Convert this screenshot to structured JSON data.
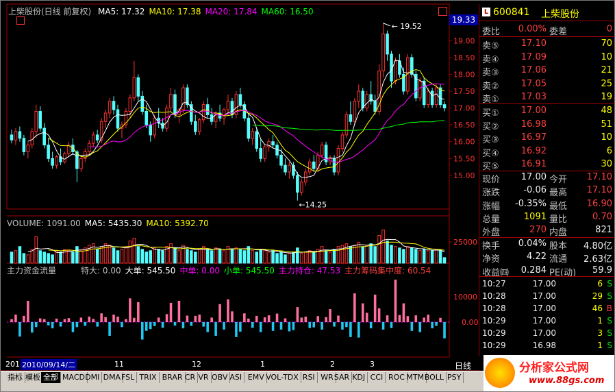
{
  "stock_title": "上柴股份(日线 前复权)",
  "ma_legend": [
    {
      "text": "MA5: 17.32",
      "color": "#ffffff"
    },
    {
      "text": "MA10: 17.38",
      "color": "#ffff00"
    },
    {
      "text": "MA20: 17.84",
      "color": "#ff00ff"
    },
    {
      "text": "MA60: 16.50",
      "color": "#00ff00"
    }
  ],
  "current_price_tag": "19.33",
  "price_axis": [
    "19.00",
    "18.50",
    "18.00",
    "17.50",
    "17.00",
    "16.50",
    "16.00",
    "15.50",
    "15.00"
  ],
  "high_marker": "19.52",
  "low_marker": "14.25",
  "volume_legend": [
    {
      "text": "VOLUME: 1091.00",
      "color": "#c0c0c0"
    },
    {
      "text": "MA5: 5435.30",
      "color": "#ffffff"
    },
    {
      "text": "MA10: 5392.70",
      "color": "#ffff00"
    }
  ],
  "volume_axis": [
    "25000"
  ],
  "flow_legend": [
    {
      "text": "主力资金流量",
      "color": "#c0c0c0"
    },
    {
      "text": "特大: 0.00",
      "color": "#c0c0c0"
    },
    {
      "text": "大单: 545.50",
      "color": "#ffffff"
    },
    {
      "text": "中单: 0.00",
      "color": "#ff00ff"
    },
    {
      "text": "小单: 545.50",
      "color": "#00ff00"
    },
    {
      "text": "主力持仓: 47.53",
      "color": "#ff00ff"
    },
    {
      "text": "主力筹码集中度: 60.54",
      "color": "#ff4040"
    }
  ],
  "flow_axis": [
    "10000",
    "0.00"
  ],
  "date_axis": {
    "current": "2010/09/14/二",
    "months": [
      "11",
      "12",
      "1",
      "2",
      "3"
    ],
    "left": "201",
    "right": "日线"
  },
  "panel": {
    "code_badge": "L",
    "code": "600841",
    "name": "上柴股份",
    "weibi_label": "委比",
    "weibi_value": "0.00%",
    "weicha_label": "委差",
    "weicha_value": "0",
    "asks": [
      {
        "label": "卖⑤",
        "price": "17.10",
        "vol": "70"
      },
      {
        "label": "卖④",
        "price": "17.09",
        "vol": "10"
      },
      {
        "label": "卖③",
        "price": "17.06",
        "vol": "21"
      },
      {
        "label": "卖②",
        "price": "17.05",
        "vol": "25"
      },
      {
        "label": "卖①",
        "price": "17.03",
        "vol": "19"
      }
    ],
    "bids": [
      {
        "label": "买①",
        "price": "17.00",
        "vol": "48"
      },
      {
        "label": "买②",
        "price": "16.98",
        "vol": "51"
      },
      {
        "label": "买③",
        "price": "16.97",
        "vol": "10"
      },
      {
        "label": "买④",
        "price": "16.92",
        "vol": "6"
      },
      {
        "label": "买⑤",
        "price": "16.91",
        "vol": "30"
      }
    ],
    "stats1": [
      {
        "l1": "现价",
        "v1": "17.00",
        "c1": "white",
        "l2": "今开",
        "v2": "17.10",
        "c2": "red"
      },
      {
        "l1": "涨跌",
        "v1": "-0.06",
        "c1": "white",
        "l2": "最高",
        "v2": "17.10",
        "c2": "red"
      },
      {
        "l1": "涨幅",
        "v1": "-0.35%",
        "c1": "white",
        "l2": "最低",
        "v2": "16.90",
        "c2": "red"
      },
      {
        "l1": "总量",
        "v1": "1091",
        "c1": "yellow",
        "l2": "量比",
        "v2": "0.70",
        "c2": "red"
      },
      {
        "l1": "外盘",
        "v1": "270",
        "c1": "red",
        "l2": "内盘",
        "v2": "821",
        "c2": "white"
      }
    ],
    "stats2": [
      {
        "l1": "换手",
        "v1": "0.04%",
        "c1": "white",
        "l2": "股本",
        "v2": "4.80亿",
        "c2": "white"
      },
      {
        "l1": "净资",
        "v1": "4.22",
        "c1": "white",
        "l2": "流通",
        "v2": "2.63亿",
        "c2": "white"
      },
      {
        "l1": "收益㈣",
        "v1": "0.284",
        "c1": "white",
        "l2": "PE(动)",
        "v2": "59.9",
        "c2": "white"
      }
    ],
    "ticks": [
      {
        "time": "10:27",
        "price": "17.00",
        "vol": "6",
        "dir": "S"
      },
      {
        "time": "10:28",
        "price": "17.00",
        "vol": "29",
        "dir": "S"
      },
      {
        "time": "10:28",
        "price": "17.00",
        "vol": "46",
        "dir": "B"
      },
      {
        "time": "10:29",
        "price": "17.00",
        "vol": "1",
        "dir": "S"
      },
      {
        "time": "10:29",
        "price": "17.00",
        "vol": "3",
        "dir": "S"
      },
      {
        "time": "10:29",
        "price": "16.98",
        "vol": "1",
        "dir": "S"
      }
    ]
  },
  "tabs": [
    "指标",
    "模板",
    "全部",
    "MACD",
    "DMI",
    "DMA",
    "FSL",
    "TRIX",
    "BRAR",
    "CR",
    "VR",
    "OBV",
    "ASI",
    "EMV",
    "VOL-TDX",
    "RSI",
    "WR",
    "SAR",
    "KDJ",
    "CCI",
    "ROC",
    "MTM",
    "BOLL",
    "PSY"
  ],
  "active_tab": "全部",
  "watermark": {
    "name": "分析家公式网",
    "url": "www.88gs.com"
  },
  "colors": {
    "up": "#ff3232",
    "down": "#54fcfc",
    "axis": "#a00000",
    "ma5": "#ffffff",
    "ma10": "#ffff00",
    "ma20": "#ff00ff",
    "ma60": "#00ff00"
  },
  "chart_data": {
    "type": "candlestick",
    "ylim": [
      14.0,
      19.8
    ],
    "candles": [
      [
        16.2,
        16.35,
        15.95,
        16.05
      ],
      [
        16.05,
        16.4,
        15.9,
        16.3
      ],
      [
        16.3,
        16.45,
        16.0,
        16.1
      ],
      [
        16.1,
        16.2,
        15.6,
        15.7
      ],
      [
        15.7,
        16.0,
        15.5,
        15.9
      ],
      [
        15.9,
        16.4,
        15.8,
        16.3
      ],
      [
        16.3,
        17.1,
        16.1,
        16.9
      ],
      [
        16.9,
        17.05,
        16.3,
        16.4
      ],
      [
        16.4,
        16.55,
        15.8,
        15.9
      ],
      [
        15.9,
        16.1,
        15.4,
        15.5
      ],
      [
        15.5,
        15.7,
        15.2,
        15.3
      ],
      [
        15.3,
        15.6,
        15.2,
        15.55
      ],
      [
        15.55,
        15.8,
        15.3,
        15.4
      ],
      [
        15.4,
        15.7,
        15.35,
        15.65
      ],
      [
        15.65,
        16.0,
        15.55,
        15.9
      ],
      [
        15.9,
        16.1,
        15.6,
        15.7
      ],
      [
        15.7,
        15.75,
        14.8,
        15.2
      ],
      [
        15.2,
        15.6,
        15.1,
        15.5
      ],
      [
        15.5,
        15.8,
        15.4,
        15.7
      ],
      [
        15.7,
        16.05,
        15.6,
        15.95
      ],
      [
        15.95,
        16.3,
        15.85,
        16.2
      ],
      [
        16.2,
        16.35,
        15.95,
        16.05
      ],
      [
        16.05,
        16.7,
        15.95,
        16.6
      ],
      [
        16.6,
        16.95,
        16.4,
        16.85
      ],
      [
        16.85,
        17.3,
        16.7,
        17.2
      ],
      [
        17.2,
        17.35,
        16.8,
        16.95
      ],
      [
        16.95,
        17.1,
        16.3,
        16.4
      ],
      [
        16.4,
        16.6,
        16.1,
        16.5
      ],
      [
        16.5,
        17.0,
        16.4,
        16.9
      ],
      [
        16.9,
        17.4,
        16.7,
        17.3
      ],
      [
        17.3,
        18.4,
        17.2,
        17.9
      ],
      [
        17.9,
        18.0,
        17.2,
        17.35
      ],
      [
        17.35,
        17.5,
        16.8,
        16.9
      ],
      [
        16.9,
        17.1,
        16.4,
        16.5
      ],
      [
        16.5,
        16.6,
        16.0,
        16.2
      ],
      [
        16.2,
        16.8,
        16.1,
        16.7
      ],
      [
        16.7,
        17.0,
        16.4,
        16.55
      ],
      [
        16.55,
        16.7,
        16.3,
        16.4
      ],
      [
        16.4,
        17.1,
        16.3,
        17.0
      ],
      [
        17.0,
        17.6,
        16.9,
        17.4
      ],
      [
        17.4,
        17.55,
        16.7,
        16.8
      ],
      [
        16.8,
        17.0,
        16.55,
        16.95
      ],
      [
        16.95,
        17.7,
        16.85,
        17.6
      ],
      [
        17.6,
        17.7,
        17.0,
        17.1
      ],
      [
        17.1,
        17.2,
        16.5,
        16.6
      ],
      [
        16.6,
        16.8,
        16.2,
        16.3
      ],
      [
        16.3,
        16.7,
        16.2,
        16.65
      ],
      [
        16.65,
        17.2,
        16.55,
        17.1
      ],
      [
        17.1,
        17.3,
        16.7,
        16.8
      ],
      [
        16.8,
        17.0,
        16.5,
        16.6
      ],
      [
        16.6,
        16.9,
        16.4,
        16.85
      ],
      [
        16.85,
        17.1,
        16.6,
        16.7
      ],
      [
        16.7,
        17.0,
        16.5,
        16.95
      ],
      [
        16.95,
        17.4,
        16.8,
        17.2
      ],
      [
        17.2,
        17.3,
        16.7,
        16.8
      ],
      [
        16.8,
        17.5,
        16.7,
        17.4
      ],
      [
        17.4,
        17.6,
        17.0,
        17.1
      ],
      [
        17.1,
        17.2,
        16.6,
        16.7
      ],
      [
        16.7,
        16.8,
        16.0,
        16.1
      ],
      [
        16.1,
        16.4,
        15.9,
        16.3
      ],
      [
        16.3,
        16.4,
        15.7,
        15.8
      ],
      [
        15.8,
        16.1,
        15.4,
        15.5
      ],
      [
        15.5,
        15.9,
        15.4,
        15.85
      ],
      [
        15.85,
        16.1,
        15.7,
        16.0
      ],
      [
        16.0,
        16.2,
        15.8,
        15.9
      ],
      [
        15.9,
        16.0,
        15.5,
        15.6
      ],
      [
        15.6,
        15.8,
        15.2,
        15.3
      ],
      [
        15.3,
        15.5,
        15.0,
        15.1
      ],
      [
        15.1,
        15.4,
        14.9,
        15.3
      ],
      [
        15.3,
        15.4,
        14.9,
        15.0
      ],
      [
        15.0,
        15.1,
        14.25,
        14.5
      ],
      [
        14.5,
        14.9,
        14.4,
        14.8
      ],
      [
        14.8,
        15.2,
        14.7,
        15.1
      ],
      [
        15.1,
        15.5,
        15.0,
        15.4
      ],
      [
        15.4,
        15.6,
        15.1,
        15.2
      ],
      [
        15.2,
        15.7,
        15.1,
        15.6
      ],
      [
        15.6,
        16.0,
        15.5,
        15.9
      ],
      [
        15.9,
        16.0,
        15.3,
        15.4
      ],
      [
        15.4,
        15.6,
        15.3,
        15.5
      ],
      [
        15.5,
        15.6,
        15.0,
        15.1
      ],
      [
        15.1,
        15.9,
        15.0,
        15.8
      ],
      [
        15.8,
        16.3,
        15.7,
        16.2
      ],
      [
        16.2,
        16.9,
        16.1,
        16.8
      ],
      [
        16.8,
        17.2,
        16.5,
        16.6
      ],
      [
        16.6,
        17.3,
        16.5,
        17.2
      ],
      [
        17.2,
        17.7,
        17.0,
        17.5
      ],
      [
        17.5,
        17.6,
        16.9,
        17.0
      ],
      [
        17.0,
        17.5,
        16.9,
        17.4
      ],
      [
        17.4,
        17.8,
        17.1,
        17.2
      ],
      [
        17.2,
        17.4,
        16.8,
        16.9
      ],
      [
        16.9,
        18.3,
        16.8,
        18.1
      ],
      [
        18.1,
        19.52,
        17.9,
        19.2
      ],
      [
        19.2,
        19.3,
        18.4,
        18.6
      ],
      [
        18.6,
        18.7,
        17.6,
        17.8
      ],
      [
        17.8,
        18.5,
        17.7,
        18.4
      ],
      [
        18.4,
        18.6,
        17.9,
        18.0
      ],
      [
        18.0,
        18.2,
        17.4,
        17.5
      ],
      [
        17.5,
        18.6,
        17.4,
        18.5
      ],
      [
        18.5,
        18.6,
        17.9,
        18.0
      ],
      [
        18.0,
        18.1,
        17.2,
        17.3
      ],
      [
        17.3,
        17.9,
        17.2,
        17.8
      ],
      [
        17.8,
        17.9,
        17.0,
        17.1
      ],
      [
        17.1,
        17.6,
        17.0,
        17.5
      ],
      [
        17.5,
        17.6,
        17.0,
        17.1
      ],
      [
        17.1,
        17.7,
        17.0,
        17.6
      ],
      [
        17.6,
        17.7,
        17.0,
        17.1
      ],
      [
        17.1,
        17.2,
        16.9,
        17.0
      ]
    ],
    "volumes": [
      8,
      9,
      12,
      7,
      6,
      10,
      19,
      9,
      8,
      7,
      6,
      9,
      8,
      10,
      9,
      8,
      12,
      9,
      11,
      13,
      14,
      10,
      12,
      14,
      13,
      11,
      9,
      10,
      12,
      16,
      18,
      12,
      10,
      8,
      9,
      11,
      10,
      9,
      12,
      14,
      11,
      9,
      13,
      10,
      9,
      8,
      10,
      12,
      10,
      9,
      11,
      10,
      9,
      12,
      10,
      11,
      10,
      9,
      12,
      9,
      8,
      10,
      9,
      8,
      9,
      7,
      8,
      6,
      7,
      8,
      11,
      7,
      8,
      9,
      8,
      10,
      12,
      9,
      8,
      10,
      12,
      13,
      14,
      12,
      13,
      15,
      12,
      13,
      14,
      12,
      20,
      24,
      16,
      13,
      12,
      11,
      10,
      12,
      11,
      10,
      9,
      10,
      9,
      9,
      10,
      9,
      4
    ],
    "flows": [
      1200,
      3000,
      -5800,
      2500,
      8500,
      -4200,
      -2000,
      1500,
      1200,
      -1300,
      -2500,
      1400,
      -1800,
      1200,
      1600,
      -4000,
      -2000,
      1800,
      -1500,
      2200,
      1300,
      -1800,
      3500,
      2000,
      -5500,
      3000,
      2200,
      -2000,
      1200,
      9500,
      1700,
      8000,
      -7000,
      -3500,
      -2800,
      -1600,
      1800,
      -2300,
      3200,
      7700,
      -1400,
      8500,
      -2500,
      2600,
      -1500,
      2500,
      3000,
      -1800,
      -4000,
      1800,
      -5500,
      7200,
      -3000,
      9100,
      4300,
      -6000,
      -3800,
      3500,
      1400,
      -2300,
      2500,
      -4000,
      1900,
      2700,
      -3500,
      3400,
      -3000,
      1500,
      -3700,
      -3200,
      6000,
      1800,
      2200,
      -2400,
      -2100,
      2400,
      -3000,
      2000,
      5200,
      -1800,
      2600,
      -3000,
      -2000,
      -6000,
      11500,
      -6200,
      7500,
      3700,
      -2500,
      11000,
      5500,
      -3000,
      2700,
      -2400,
      17000,
      2800,
      7500,
      2400,
      -3500,
      2700,
      -4000,
      1800,
      3000,
      -2500,
      -1500,
      1700,
      -6500
    ]
  }
}
